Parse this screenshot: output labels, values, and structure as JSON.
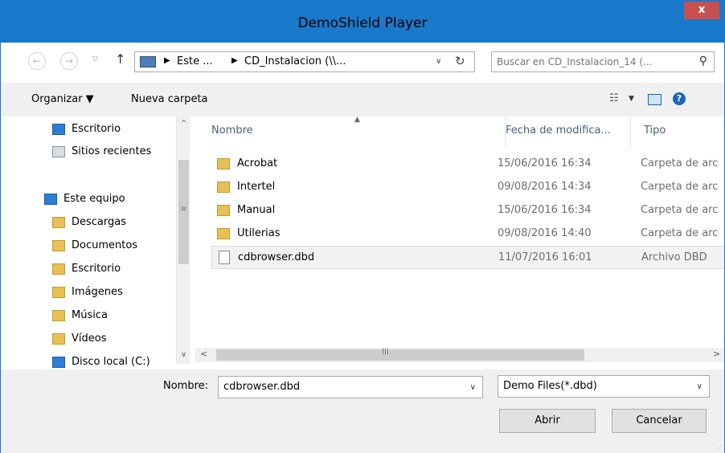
{
  "window": {
    "title": "DemoShield Player",
    "close_label": "x"
  },
  "address": {
    "path": [
      "Este ...",
      "CD_Instalacion (\\\\..."
    ],
    "search_placeholder": "Buscar en CD_Instalacion_14 (..."
  },
  "toolbar": {
    "organize": "Organizar ▼",
    "new_folder": "Nueva carpeta"
  },
  "nav": {
    "items": [
      {
        "label": "Escritorio",
        "icon": "desktop-icon"
      },
      {
        "label": "Sitios recientes",
        "icon": "recent-places-icon"
      },
      {
        "label": "Este equipo",
        "icon": "computer-icon"
      },
      {
        "label": "Descargas",
        "icon": "downloads-icon"
      },
      {
        "label": "Documentos",
        "icon": "documents-icon"
      },
      {
        "label": "Escritorio",
        "icon": "desktop-folder-icon"
      },
      {
        "label": "Imágenes",
        "icon": "pictures-icon"
      },
      {
        "label": "Música",
        "icon": "music-icon"
      },
      {
        "label": "Vídeos",
        "icon": "videos-icon"
      },
      {
        "label": "Disco local (C:)",
        "icon": "local-disk-icon"
      }
    ]
  },
  "files": {
    "columns": [
      "Nombre",
      "Fecha de modifica...",
      "Tipo"
    ],
    "rows": [
      {
        "name": "Acrobat",
        "date": "15/06/2016 16:34",
        "type": "Carpeta de arc",
        "kind": "folder"
      },
      {
        "name": "Intertel",
        "date": "09/08/2016 14:34",
        "type": "Carpeta de arc",
        "kind": "folder"
      },
      {
        "name": "Manual",
        "date": "15/06/2016 16:34",
        "type": "Carpeta de arc",
        "kind": "folder"
      },
      {
        "name": "Utilerias",
        "date": "09/08/2016 14:40",
        "type": "Carpeta de arc",
        "kind": "folder"
      },
      {
        "name": "cdbrowser.dbd",
        "date": "11/07/2016 16:01",
        "type": "Archivo DBD",
        "kind": "file"
      }
    ]
  },
  "bottom": {
    "name_label": "Nombre:",
    "filename": "cdbrowser.dbd",
    "filter": "Demo Files(*.dbd)",
    "open_button": "Abrir",
    "cancel_button": "Cancelar"
  },
  "colors": {
    "titlebar": "#1979ca",
    "close": "#c75050",
    "folder": "#e7c157"
  }
}
